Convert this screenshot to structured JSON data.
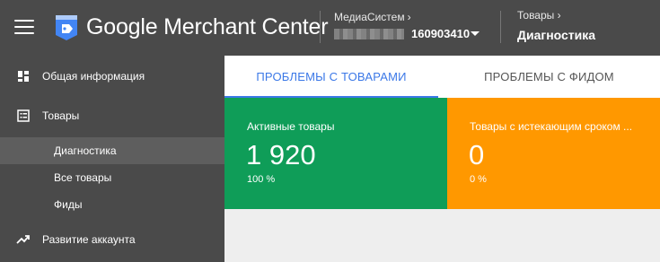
{
  "app": {
    "title": "Google Merchant Center",
    "menu_icon": "hamburger-menu-icon",
    "logo_icon": "merchant-tag-icon"
  },
  "account": {
    "name": "МедиаСистем",
    "id": "160903410",
    "chevron": "›"
  },
  "breadcrumb": {
    "parent": "Товары",
    "chevron": "›",
    "current": "Диагностика"
  },
  "sidebar": {
    "items": [
      {
        "label": "Общая информация",
        "icon": "dashboard-icon"
      },
      {
        "label": "Товары",
        "icon": "list-icon"
      },
      {
        "label": "Развитие аккаунта",
        "icon": "trending-up-icon"
      }
    ],
    "subitems": [
      {
        "label": "Диагностика",
        "active": true
      },
      {
        "label": "Все товары",
        "active": false
      },
      {
        "label": "Фиды",
        "active": false
      }
    ]
  },
  "tabs": [
    {
      "label": "ПРОБЛЕМЫ С ТОВАРАМИ",
      "active": true
    },
    {
      "label": "ПРОБЛЕМЫ С ФИДОМ",
      "active": false
    }
  ],
  "cards": [
    {
      "title": "Активные товары",
      "value": "1 920",
      "percent": "100 %",
      "color": "#0f9d58"
    },
    {
      "title": "Товары с истекающим сроком ...",
      "value": "0",
      "percent": "0 %",
      "color": "#ff9800"
    }
  ],
  "colors": {
    "topbar": "#4a4a4a",
    "accent": "#3b78e7",
    "active_green": "#0f9d58",
    "expiring_orange": "#ff9800"
  }
}
